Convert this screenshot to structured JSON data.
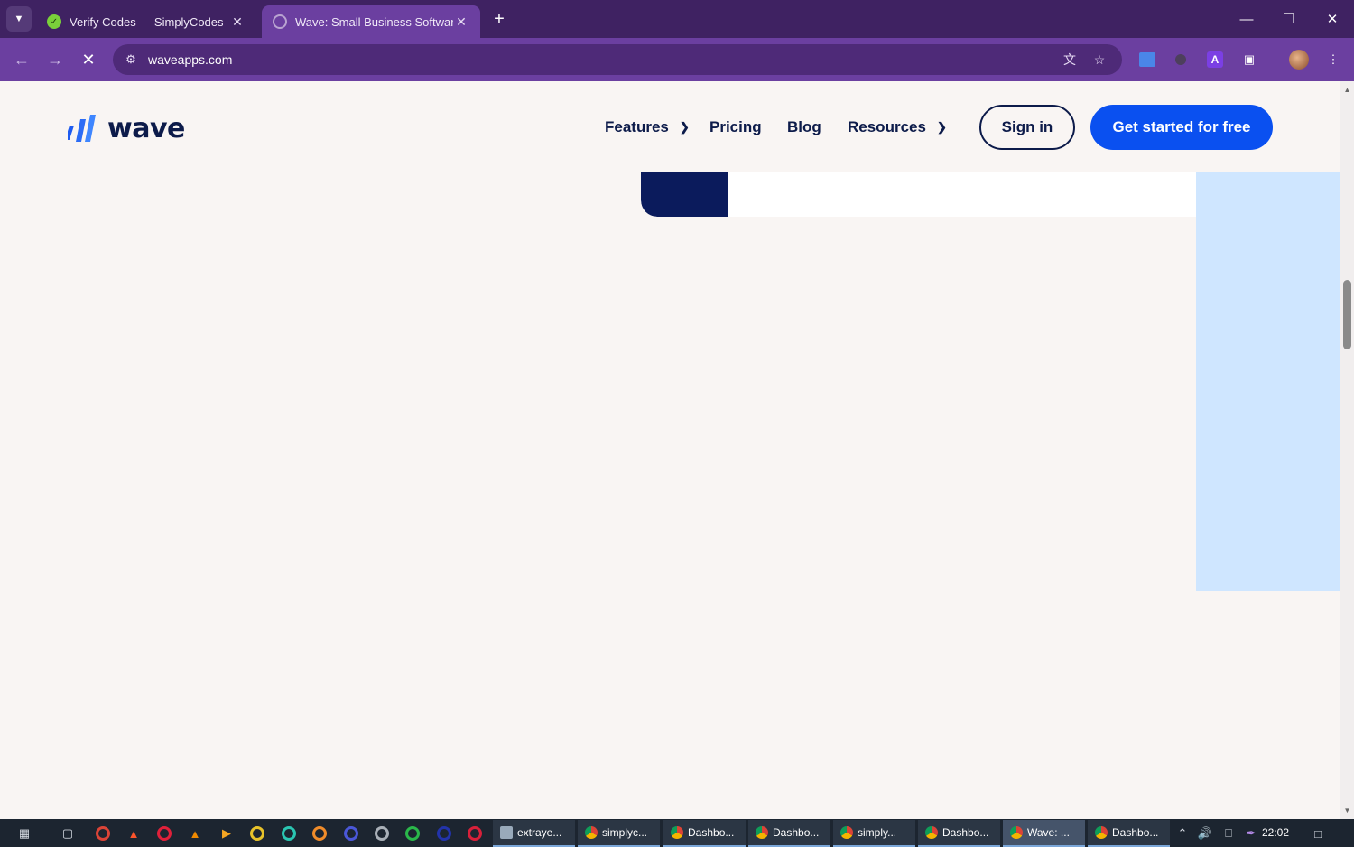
{
  "browser": {
    "tabs": [
      {
        "title": "Verify Codes — SimplyCodes",
        "active": false
      },
      {
        "title": "Wave: Small Business Software",
        "active": true
      }
    ],
    "tab_search_icon": "chevron-down-icon",
    "new_tab_icon": "plus-icon",
    "window_controls": [
      "minimize-icon",
      "restore-icon",
      "close-icon"
    ],
    "url": "waveapps.com",
    "loading": true
  },
  "site": {
    "logo_text": "wave",
    "nav": {
      "features": "Features",
      "pricing": "Pricing",
      "blog": "Blog",
      "resources": "Resources"
    },
    "sign_in": "Sign in",
    "get_started": "Get started for free",
    "colors": {
      "primary": "#0a50f0",
      "navy": "#0d1b4a",
      "background": "#f9f5f3",
      "light_blue_panel": "#cfe6ff"
    }
  },
  "taskbar": {
    "apps": [
      {
        "label": "extraye...",
        "type": "doc"
      },
      {
        "label": "simplyc...",
        "type": "chrome"
      },
      {
        "label": "Dashbo...",
        "type": "chrome"
      },
      {
        "label": "Dashbo...",
        "type": "chrome"
      },
      {
        "label": "simply...",
        "type": "chrome"
      },
      {
        "label": "Dashbo...",
        "type": "chrome"
      },
      {
        "label": "Wave: ...",
        "type": "chrome",
        "active": true
      },
      {
        "label": "Dashbo...",
        "type": "chrome"
      }
    ],
    "time": "22:02"
  }
}
